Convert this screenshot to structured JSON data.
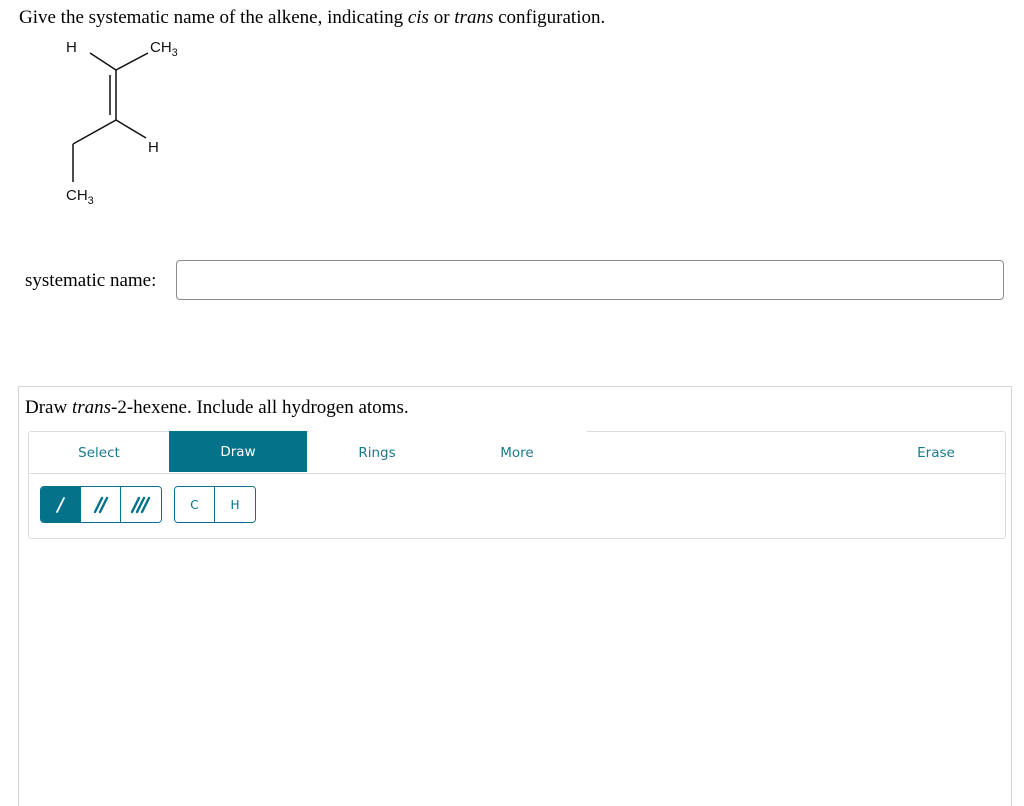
{
  "question": {
    "prefix": "Give the systematic name of the alkene, indicating ",
    "cis": "cis",
    "or": " or ",
    "trans": "trans",
    "suffix": " configuration."
  },
  "molecule": {
    "atoms": {
      "h_top": "H",
      "ch3_top": "CH",
      "ch3_top_sub": "3",
      "h_right": "H",
      "ch3_bottom": "CH",
      "ch3_bottom_sub": "3"
    }
  },
  "answer": {
    "label": "systematic name:",
    "value": "",
    "placeholder": ""
  },
  "draw": {
    "prompt_prefix": "Draw ",
    "prompt_italic": "trans",
    "prompt_suffix": "-2-hexene. Include all hydrogen atoms.",
    "tabs": [
      {
        "label": "Select",
        "active": false
      },
      {
        "label": "Draw",
        "active": true
      },
      {
        "label": "Rings",
        "active": false
      },
      {
        "label": "More",
        "active": false
      },
      {
        "label": "Erase",
        "active": false
      }
    ],
    "bond_tools": [
      "single-bond",
      "double-bond",
      "triple-bond"
    ],
    "atom_tools": [
      "C",
      "H"
    ]
  },
  "colors": {
    "accent": "#04738a",
    "tab_text": "#1c7a8c"
  }
}
